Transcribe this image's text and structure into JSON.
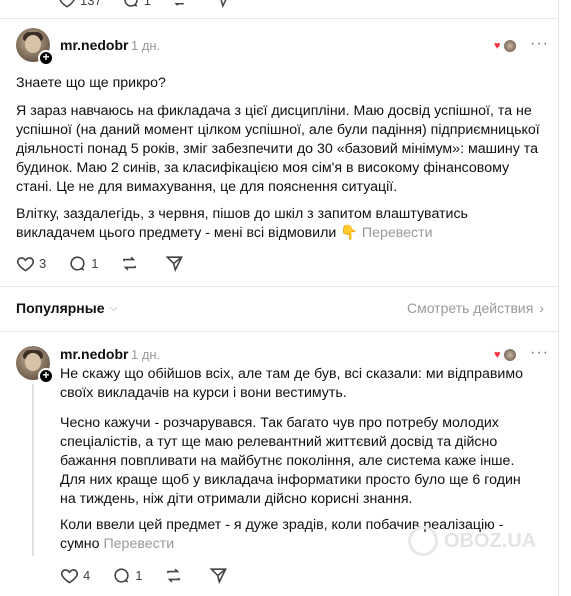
{
  "previous_post": {
    "likes": "137",
    "replies": "1"
  },
  "post1": {
    "username": "mr.nedobr",
    "time": "1 дн.",
    "paragraphs": [
      "Знаете що ще прикро?",
      "Я зараз навчаюсь на фикладача з цієї дисципліни. Маю досвід успішної, та не успішної (на даний момент цілком успішної, але були падіння) підприємницької діяльності понад 5 років, зміг забезпечити до 30 «базовий мінімум»: машину та будинок. Маю 2 синів, за класифікацією моя сім'я в високому фінансовому стані. Це не для вимахування, це для пояснення ситуації.",
      "Влітку, заздалегідь, з червня, пішов до шкіл з запитом влаштуватись викладачем цього предмету - мені всі відмовили 👇"
    ],
    "translate_label": "Перевести",
    "likes": "3",
    "replies": "1"
  },
  "section": {
    "sort_label": "Популярные",
    "view_activity_label": "Смотреть действия"
  },
  "post2": {
    "username": "mr.nedobr",
    "time": "1 дн.",
    "paragraphs": [
      "Не скажу що обійшов всіх, але там де був, всі сказали: ми відправимо своїх викладачів на курси і вони вестимуть.",
      "Чесно кажучи - розчарувався. Так багато чув про потребу молодих спеціалістів, а тут ще маю релевантний життєвий досвід та дійсно бажання повпливати на майбутнє покоління, але система каже інше. Для них краще щоб у викладача інформатики просто було ще 6 годин на тиждень, ніж діти отримали дійсно корисні знання.",
      "Коли ввели цей предмет - я дуже зрадів, коли побачив реалізацію - сумно"
    ],
    "translate_label": "Перевести",
    "likes": "4",
    "replies": "1"
  },
  "watermark": "OBOZ.UA",
  "colors": {
    "text": "#101010",
    "secondary": "#999999",
    "heart": "#ff3040",
    "divider": "#e6e6e6"
  }
}
